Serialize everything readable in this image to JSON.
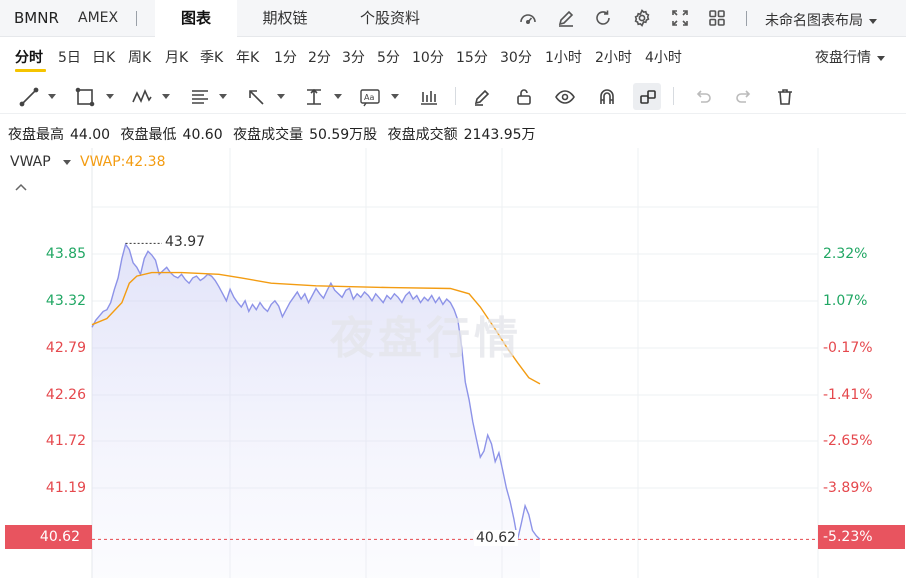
{
  "header": {
    "symbol": "BMNR",
    "exchange": "AMEX",
    "tabs": [
      {
        "label": "图表",
        "active": true
      },
      {
        "label": "期权链",
        "active": false
      },
      {
        "label": "个股资料",
        "active": false
      }
    ],
    "icons": [
      "speedometer-icon",
      "edit-icon",
      "refresh-icon",
      "gear-icon",
      "fullscreen-icon",
      "grid-icon"
    ],
    "layout_label": "未命名图表布局"
  },
  "intervals": {
    "items": [
      "分时",
      "5日",
      "日K",
      "周K",
      "月K",
      "季K",
      "年K",
      "1分",
      "2分",
      "3分",
      "5分",
      "10分",
      "15分",
      "30分",
      "1小时",
      "2小时",
      "4小时"
    ],
    "active": "分时",
    "session_label": "夜盘行情"
  },
  "draw_tools": [
    "line-tool-icon",
    "rect-tool-icon",
    "pattern-tool-icon",
    "fib-tool-icon",
    "arrow-tool-icon",
    "measure-tool-icon",
    "text-tool-icon",
    "bars-tool-icon",
    "pen-icon",
    "lock-icon",
    "eye-icon",
    "magnet-icon",
    "link-icon",
    "undo-icon",
    "redo-icon",
    "trash-icon"
  ],
  "stats": {
    "high_label": "夜盘最高",
    "high_value": "44.00",
    "low_label": "夜盘最低",
    "low_value": "40.60",
    "vol_label": "夜盘成交量",
    "vol_value": "50.59万股",
    "amt_label": "夜盘成交额",
    "amt_value": "2143.95万"
  },
  "indicator": {
    "name": "VWAP",
    "value": "VWAP:42.38"
  },
  "watermark": "夜盘行情",
  "colors": {
    "price_line": "#8d93e8",
    "vwap_line": "#f39c12",
    "up": "#21a764",
    "down": "#e5484d",
    "last_badge": "#e8545f"
  },
  "chart_data": {
    "type": "area",
    "y_ticks": [
      "43.85",
      "43.32",
      "42.79",
      "42.26",
      "41.72",
      "41.19"
    ],
    "pct_ticks": [
      "2.32%",
      "1.07%",
      "-0.17%",
      "-1.41%",
      "-2.65%",
      "-3.89%"
    ],
    "last_price": "40.62",
    "last_pct": "-5.23%",
    "high_annotation": "43.97",
    "low_annotation": "40.62",
    "ylim": [
      40.45,
      44.3
    ],
    "xlim": [
      0,
      160
    ],
    "price": [
      [
        0,
        43.02
      ],
      [
        1,
        43.1
      ],
      [
        2,
        43.15
      ],
      [
        3,
        43.2
      ],
      [
        4,
        43.22
      ],
      [
        5,
        43.3
      ],
      [
        6,
        43.45
      ],
      [
        7,
        43.58
      ],
      [
        8,
        43.8
      ],
      [
        9,
        43.96
      ],
      [
        10,
        43.9
      ],
      [
        11,
        43.75
      ],
      [
        12,
        43.7
      ],
      [
        13,
        43.62
      ],
      [
        14,
        43.8
      ],
      [
        15,
        43.88
      ],
      [
        16,
        43.84
      ],
      [
        17,
        43.78
      ],
      [
        18,
        43.62
      ],
      [
        19,
        43.66
      ],
      [
        20,
        43.7
      ],
      [
        21,
        43.64
      ],
      [
        22,
        43.6
      ],
      [
        23,
        43.58
      ],
      [
        24,
        43.62
      ],
      [
        25,
        43.56
      ],
      [
        26,
        43.52
      ],
      [
        27,
        43.58
      ],
      [
        28,
        43.6
      ],
      [
        29,
        43.55
      ],
      [
        30,
        43.58
      ],
      [
        31,
        43.62
      ],
      [
        32,
        43.6
      ],
      [
        33,
        43.55
      ],
      [
        34,
        43.48
      ],
      [
        35,
        43.4
      ],
      [
        36,
        43.32
      ],
      [
        37,
        43.45
      ],
      [
        38,
        43.36
      ],
      [
        39,
        43.3
      ],
      [
        40,
        43.25
      ],
      [
        41,
        43.32
      ],
      [
        42,
        43.2
      ],
      [
        43,
        43.28
      ],
      [
        44,
        43.22
      ],
      [
        45,
        43.3
      ],
      [
        46,
        43.24
      ],
      [
        47,
        43.2
      ],
      [
        48,
        43.28
      ],
      [
        49,
        43.32
      ],
      [
        50,
        43.26
      ],
      [
        51,
        43.14
      ],
      [
        52,
        43.22
      ],
      [
        53,
        43.3
      ],
      [
        54,
        43.36
      ],
      [
        55,
        43.42
      ],
      [
        56,
        43.34
      ],
      [
        57,
        43.4
      ],
      [
        58,
        43.3
      ],
      [
        59,
        43.38
      ],
      [
        60,
        43.46
      ],
      [
        61,
        43.4
      ],
      [
        62,
        43.35
      ],
      [
        63,
        43.44
      ],
      [
        64,
        43.52
      ],
      [
        65,
        43.44
      ],
      [
        66,
        43.4
      ],
      [
        67,
        43.36
      ],
      [
        68,
        43.44
      ],
      [
        69,
        43.46
      ],
      [
        70,
        43.34
      ],
      [
        71,
        43.4
      ],
      [
        72,
        43.36
      ],
      [
        73,
        43.42
      ],
      [
        74,
        43.38
      ],
      [
        75,
        43.32
      ],
      [
        76,
        43.4
      ],
      [
        77,
        43.35
      ],
      [
        78,
        43.3
      ],
      [
        79,
        43.38
      ],
      [
        80,
        43.34
      ],
      [
        81,
        43.4
      ],
      [
        82,
        43.36
      ],
      [
        83,
        43.3
      ],
      [
        84,
        43.38
      ],
      [
        85,
        43.42
      ],
      [
        86,
        43.34
      ],
      [
        87,
        43.38
      ],
      [
        88,
        43.3
      ],
      [
        89,
        43.36
      ],
      [
        90,
        43.32
      ],
      [
        91,
        43.38
      ],
      [
        92,
        43.3
      ],
      [
        93,
        43.36
      ],
      [
        94,
        43.28
      ],
      [
        95,
        43.34
      ],
      [
        96,
        43.3
      ],
      [
        97,
        43.22
      ],
      [
        98,
        43.1
      ],
      [
        99,
        42.8
      ],
      [
        100,
        42.4
      ],
      [
        101,
        42.2
      ],
      [
        102,
        41.95
      ],
      [
        103,
        41.75
      ],
      [
        104,
        41.55
      ],
      [
        105,
        41.62
      ],
      [
        106,
        41.8
      ],
      [
        107,
        41.7
      ],
      [
        108,
        41.5
      ],
      [
        109,
        41.6
      ],
      [
        110,
        41.4
      ],
      [
        111,
        41.2
      ],
      [
        112,
        41.05
      ],
      [
        113,
        40.85
      ],
      [
        114,
        40.62
      ],
      [
        115,
        40.8
      ],
      [
        116,
        41.0
      ],
      [
        117,
        40.9
      ],
      [
        118,
        40.72
      ],
      [
        119,
        40.66
      ],
      [
        120,
        40.62
      ]
    ],
    "vwap": [
      [
        0,
        43.05
      ],
      [
        4,
        43.12
      ],
      [
        8,
        43.3
      ],
      [
        10,
        43.52
      ],
      [
        12,
        43.6
      ],
      [
        16,
        43.64
      ],
      [
        24,
        43.64
      ],
      [
        34,
        43.62
      ],
      [
        40,
        43.58
      ],
      [
        48,
        43.52
      ],
      [
        60,
        43.49
      ],
      [
        80,
        43.47
      ],
      [
        96,
        43.46
      ],
      [
        101,
        43.4
      ],
      [
        104,
        43.25
      ],
      [
        108,
        43.0
      ],
      [
        111,
        42.8
      ],
      [
        114,
        42.62
      ],
      [
        117,
        42.45
      ],
      [
        120,
        42.38
      ]
    ]
  }
}
